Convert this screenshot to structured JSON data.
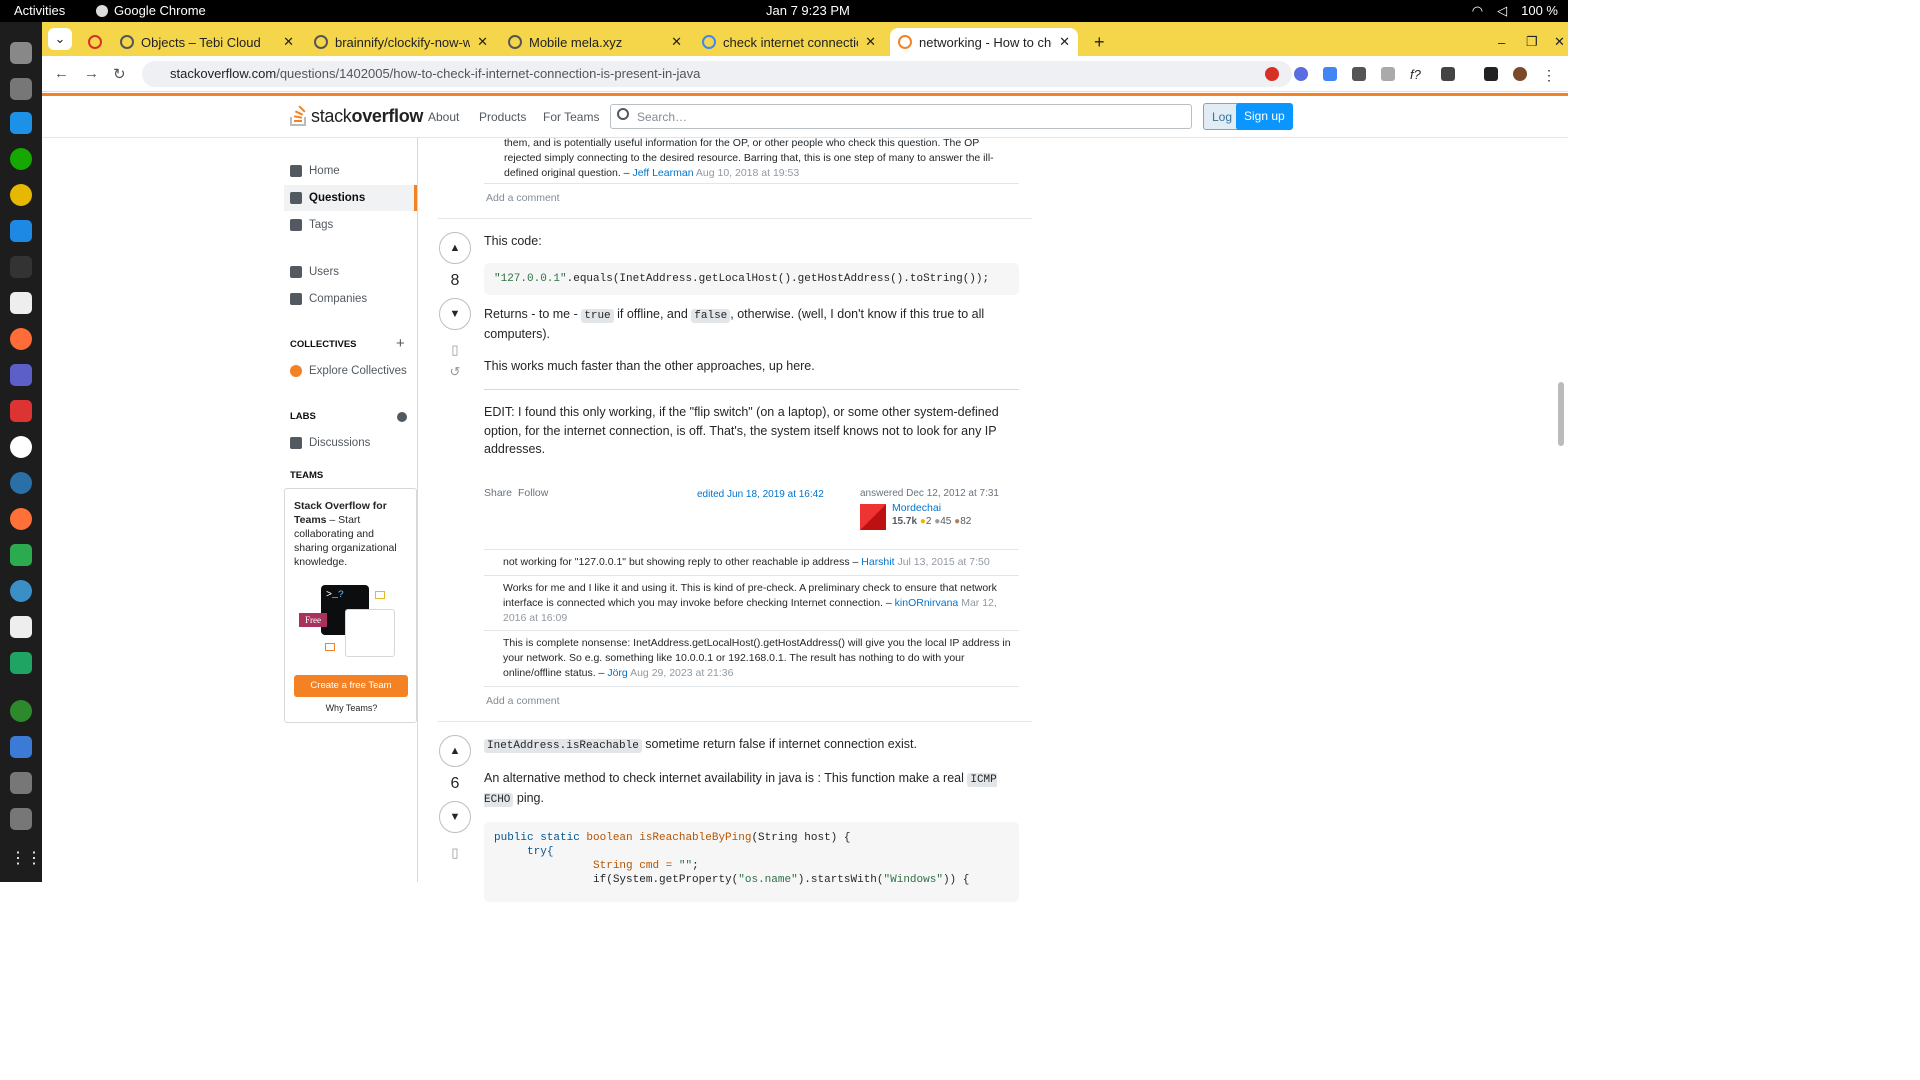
{
  "os": {
    "activities": "Activities",
    "app": "Google Chrome",
    "clock": "Jan 7  9:23 PM",
    "battery": "100 %"
  },
  "tabs": [
    {
      "label": "Objects – Tebi Cloud"
    },
    {
      "label": "brainnify/clockify-now-w"
    },
    {
      "label": "Mobile mela.xyz"
    },
    {
      "label": "check internet connectic"
    },
    {
      "label": "networking - How to che"
    }
  ],
  "address": {
    "url_host": "stackoverflow.com",
    "url_path": "/questions/1402005/how-to-check-if-internet-connection-is-present-in-java"
  },
  "so": {
    "logo_a": "stack",
    "logo_b": "overflow",
    "nav": [
      "About",
      "Products",
      "For Teams"
    ],
    "search_placeholder": "Search…",
    "login": "Log in",
    "signup": "Sign up"
  },
  "sidebar": {
    "home": "Home",
    "questions": "Questions",
    "tags": "Tags",
    "users": "Users",
    "companies": "Companies",
    "collectives": "COLLECTIVES",
    "explore": "Explore Collectives",
    "labs": "LABS",
    "discussions": "Discussions",
    "teams": "TEAMS",
    "teams_title": "Stack Overflow for Teams",
    "teams_text": " – Start collaborating and sharing organizational knowledge.",
    "free": "Free",
    "create": "Create a free Team",
    "why": "Why Teams?"
  },
  "prev": {
    "text": "them, and is potentially useful information for the OP, or other people who check this question. The OP rejected simply connecting to the desired resource. Barring that, this is one step of many to answer the ill-defined original question. –",
    "user": "Jeff Learman",
    "date": "Aug 10, 2018 at 19:53",
    "add": "Add a comment"
  },
  "a1": {
    "votes": "8",
    "p1": "This code:",
    "code": "\"127.0.0.1\"",
    "code_rest": ".equals(InetAddress.getLocalHost().getHostAddress().toString());",
    "p2a": "Returns - to me - ",
    "p2t": "true",
    "p2b": " if offline, and ",
    "p2f": "false",
    "p2c": ", otherwise. (well, I don't know if this true to all computers).",
    "p3": "This works much faster than the other approaches, up here.",
    "p4": "EDIT: I found this only working, if the \"flip switch\" (on a laptop), or some other system-defined option, for the internet connection, is off. That's, the system itself knows not to look for any IP addresses.",
    "share": "Share",
    "follow": "Follow",
    "edited": "edited Jun 18, 2019 at 16:42",
    "answered": "answered Dec 12, 2012 at 7:31",
    "user": "Mordechai",
    "rep": "15.7k",
    "gold": "2",
    "silver": "45",
    "bronze": "82",
    "comments": [
      {
        "text": "not working for \"127.0.0.1\" but showing reply to other reachable ip address –",
        "user": "Harshit",
        "date": "Jul 13, 2015 at 7:50"
      },
      {
        "text": "Works for me and I like it and using it. This is kind of pre-check. A preliminary check to ensure that network interface is connected which you may invoke before checking Internet connection. –",
        "user": "kinORnirvana",
        "date": "Mar 12, 2016 at 16:09"
      },
      {
        "text": "This is complete nonsense: InetAddress.getLocalHost().getHostAddress() will give you the local IP address in your network. So e.g. something like 10.0.0.1 or 192.168.0.1. The result has nothing to do with your online/offline status. –",
        "user": "Jörg",
        "date": "Aug 29, 2023 at 21:36"
      }
    ],
    "add": "Add a comment"
  },
  "a2": {
    "votes": "6",
    "code1": "InetAddress.isReachable",
    "p1": " sometime return false if internet connection exist.",
    "p2": "An alternative method to check internet availability in java is : This function make a real ",
    "p2c": "ICMP ECHO",
    "p2b": " ping.",
    "l1a": "public static ",
    "l1b": "boolean ",
    "l1c": "isReachableByPing",
    "l1d": "(String host) {",
    "l2": "try{",
    "l3a": "String cmd = ",
    "l3b": "\"\"",
    "l3c": ";",
    "l4a": "if(System.getProperty(",
    "l4b": "\"os.name\"",
    "l4c": ").startsWith(",
    "l4d": "\"Windows\"",
    "l4e": ")) {"
  }
}
